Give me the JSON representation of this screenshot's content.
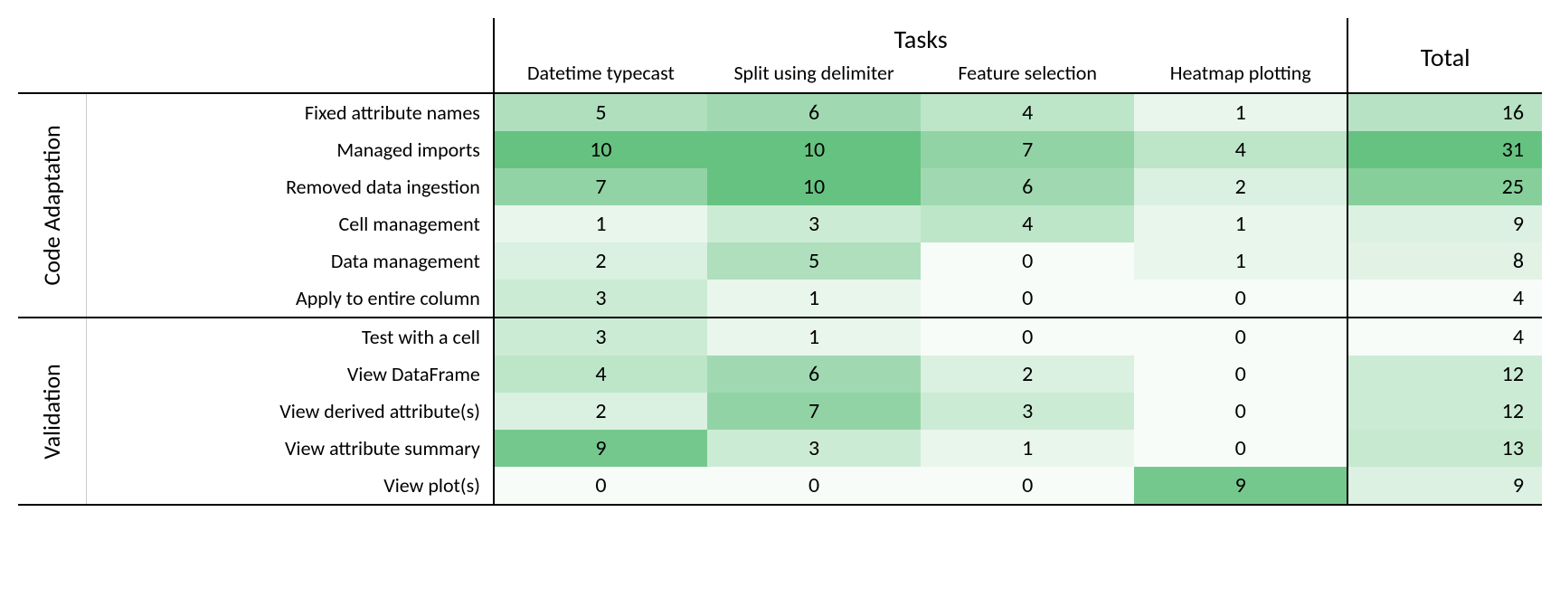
{
  "chart_data": {
    "type": "heatmap",
    "title": "",
    "col_super_header": "Tasks",
    "total_header": "Total",
    "columns": [
      "Datetime typecast",
      "Split using delimiter",
      "Feature selection",
      "Heatmap plotting"
    ],
    "row_groups": [
      {
        "name": "Code Adaptation",
        "rows": [
          {
            "label": "Fixed attribute names",
            "values": [
              5,
              6,
              4,
              1
            ],
            "total": 16
          },
          {
            "label": "Managed imports",
            "values": [
              10,
              10,
              7,
              4
            ],
            "total": 31
          },
          {
            "label": "Removed data ingestion",
            "values": [
              7,
              10,
              6,
              2
            ],
            "total": 25
          },
          {
            "label": "Cell management",
            "values": [
              1,
              3,
              4,
              1
            ],
            "total": 9
          },
          {
            "label": "Data management",
            "values": [
              2,
              5,
              0,
              1
            ],
            "total": 8
          },
          {
            "label": "Apply to entire column",
            "values": [
              3,
              1,
              0,
              0
            ],
            "total": 4
          }
        ]
      },
      {
        "name": "Validation",
        "rows": [
          {
            "label": "Test with a cell",
            "values": [
              3,
              1,
              0,
              0
            ],
            "total": 4
          },
          {
            "label": "View DataFrame",
            "values": [
              4,
              6,
              2,
              0
            ],
            "total": 12
          },
          {
            "label": "View derived attribute(s)",
            "values": [
              2,
              7,
              3,
              0
            ],
            "total": 12
          },
          {
            "label": "View attribute summary",
            "values": [
              9,
              3,
              1,
              0
            ],
            "total": 13
          },
          {
            "label": "View plot(s)",
            "values": [
              0,
              0,
              0,
              9
            ],
            "total": 9
          }
        ]
      }
    ],
    "color_scale": {
      "data_min": 0,
      "data_max": 10,
      "total_min": 4,
      "total_max": 31,
      "low_color": "#f7fcf8",
      "high_color": "#66c281"
    }
  }
}
